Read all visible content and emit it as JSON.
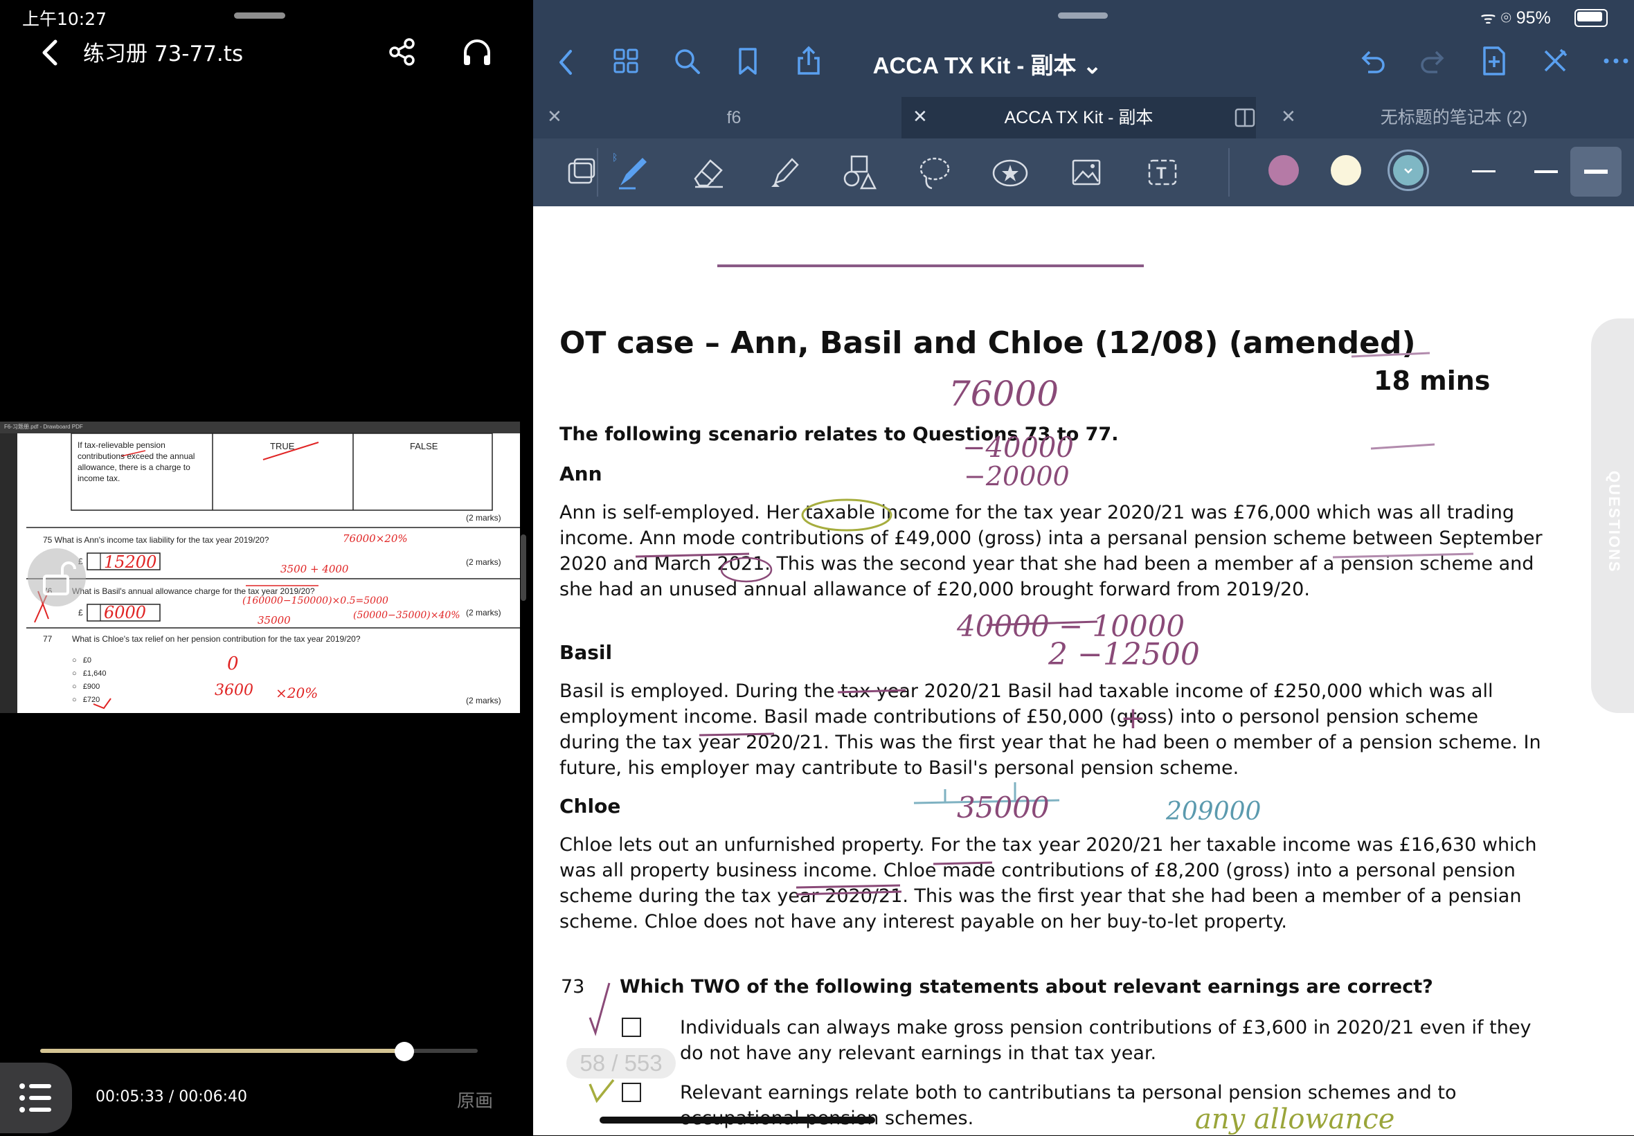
{
  "status_bar": {
    "time": "上午10:27",
    "signal": "ᯤ ⌾",
    "battery_pct": "95%"
  },
  "player": {
    "title": "练习册 73-77.ts",
    "time_readout": "00:05:33 / 00:06:40",
    "progress": 0.832,
    "origin_label": "原画",
    "frame": {
      "window_title": "F6-习题册.pdf - Drawboard PDF",
      "statement": "If tax-relievable pension contributions exceed the annual allowance, there is a charge to income tax.",
      "true_label": "TRUE",
      "false_label": "FALSE",
      "marks": "(2 marks)",
      "q75": "75 What is Ann's income tax liability for the tax year 2019/20?",
      "q75_answer": "15200",
      "q76_num": "76",
      "q76": "What is Basil's annual allowance charge for the tax year 2019/20?",
      "q76_answer": "6000",
      "q77_num": "77",
      "q77": "What is Chloe's tax relief on her pension contribution for the tax year 2019/20?",
      "q77_options": [
        "£0",
        "£1,640",
        "£900",
        "£720"
      ],
      "currency": "£",
      "ink_75a": "76000×20%",
      "ink_75b": "3500 + 4000",
      "ink_76a": "(160000−150000)×0.5=5000",
      "ink_76b": "35000",
      "ink_76c": "(50000−35000)×40%",
      "ink_77a": "0",
      "ink_77b": "3600",
      "ink_77c": "×20%"
    }
  },
  "notes_app": {
    "doc_title": "ACCA TX Kit - 副本 ⌄",
    "tabs": [
      {
        "label": "f6",
        "active": false
      },
      {
        "label": "ACCA TX Kit - 副本",
        "active": true
      },
      {
        "label": "无标题的笔记本 (2)",
        "active": false
      }
    ],
    "pen_colors": [
      "#b57aa6",
      "#faf5dc",
      "#7fb7c4"
    ],
    "page_counter": "58 / 553",
    "side_tab": "QUESTIONS",
    "page": {
      "title": "OT case – Ann, Basil and Chloe (12/08) (amended)",
      "time": "18 mins",
      "intro": "The following scenario relates to Questions 73 to 77.",
      "ann_heading": "Ann",
      "ann_text": "Ann is self-employed. Her taxable income for the tax year 2020/21 was £76,000 which was all trading income. Ann mode contributions of £49,000 (gross) inta a persanal pension scheme between September 2020 and March 2021. This was the second year that she had been a member af a pension scheme and she had an unused annual allawance of £20,000 brought forward from 2019/20.",
      "basil_heading": "Basil",
      "basil_text": "Basil is employed. During the tax year 2020/21 Basil had taxable income of £250,000 which was all employment income. Basil made contributions of £50,000 (gross) into o personol pension scheme during the tax year 2020/21. This was the first year that he had been o member of a pension scheme. In future, his employer may cantribute to Basil's personal pension scheme.",
      "chloe_heading": "Chloe",
      "chloe_text": "Chloe lets out an unfurnished property. For the tax year 2020/21 her taxable income was £16,630 which was all property business income. Chloe made contributions of £8,200 (gross) into a personal pension scheme during the tax year 2020/21. This was the first year that she had been a member of a pensian scheme. Chloe does not have any interest payable on her buy-to-let property.",
      "q73_num": "73",
      "q73_text": "Which TWO of the following statements about relevant earnings are correct?",
      "q73_opt1": "Individuals can always make gross pension contributions of £3,600 in 2020/21 even if they do not have any relevant earnings in that tax year.",
      "q73_opt2": "Relevant earnings relate both to cantributians ta personal pension schemes and to occupational pension schemes."
    },
    "handwriting": {
      "n1": "76000",
      "n2": "−40000",
      "n3": "−20000",
      "n4": "40000 − 10000",
      "n5": "2  −12500",
      "n6": "+",
      "n7": "35000",
      "n8": "209000",
      "n9": "any allowance"
    }
  }
}
